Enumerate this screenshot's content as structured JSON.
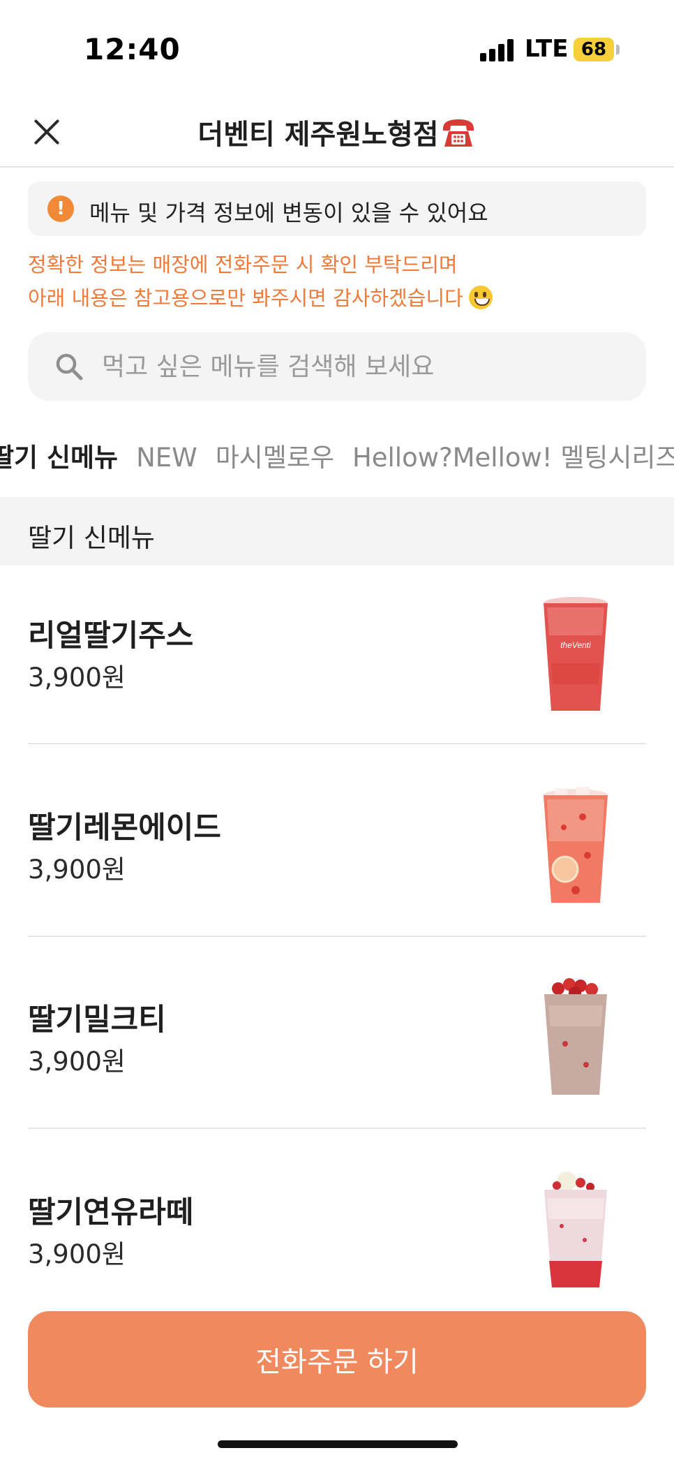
{
  "status_bar": {
    "time": "12:40",
    "network": "LTE",
    "battery": "68",
    "battery_color": "#f7cf3a"
  },
  "header": {
    "title": "더벤티 제주원노형점",
    "close_icon": "close-icon",
    "phone_icon": "telephone-icon"
  },
  "notice": {
    "icon": "exclamation-circle-icon",
    "text": "메뉴 및 가격 정보에 변동이 있을 수 있어요",
    "disclaimer_line1": "정확한 정보는 매장에 전화주문 시 확인 부탁드리며",
    "disclaimer_line2": "아래 내용은 참고용으로만 봐주시면 감사하겠습니다",
    "disclaimer_color": "#f07a3a"
  },
  "search": {
    "placeholder": "먹고 싶은 메뉴를 검색해 보세요",
    "value": ""
  },
  "tabs": [
    {
      "label": "딸기 신메뉴",
      "active": true
    },
    {
      "label": "NEW",
      "active": false
    },
    {
      "label": "마시멜로우",
      "active": false
    },
    {
      "label": "Hellow?Mellow! 멜팅시리즈",
      "active": false
    }
  ],
  "section": {
    "title": "딸기 신메뉴"
  },
  "menu_items": [
    {
      "name": "리얼딸기주스",
      "price": "3,900원",
      "image": "strawberry-juice-cup"
    },
    {
      "name": "딸기레몬에이드",
      "price": "3,900원",
      "image": "strawberry-lemonade-cup"
    },
    {
      "name": "딸기밀크티",
      "price": "3,900원",
      "image": "strawberry-milk-tea-cup"
    },
    {
      "name": "딸기연유라떼",
      "price": "3,900원",
      "image": "strawberry-condensed-milk-latte-cup"
    }
  ],
  "call_button": {
    "label": "전화주문 하기",
    "color": "#f08a5e"
  }
}
